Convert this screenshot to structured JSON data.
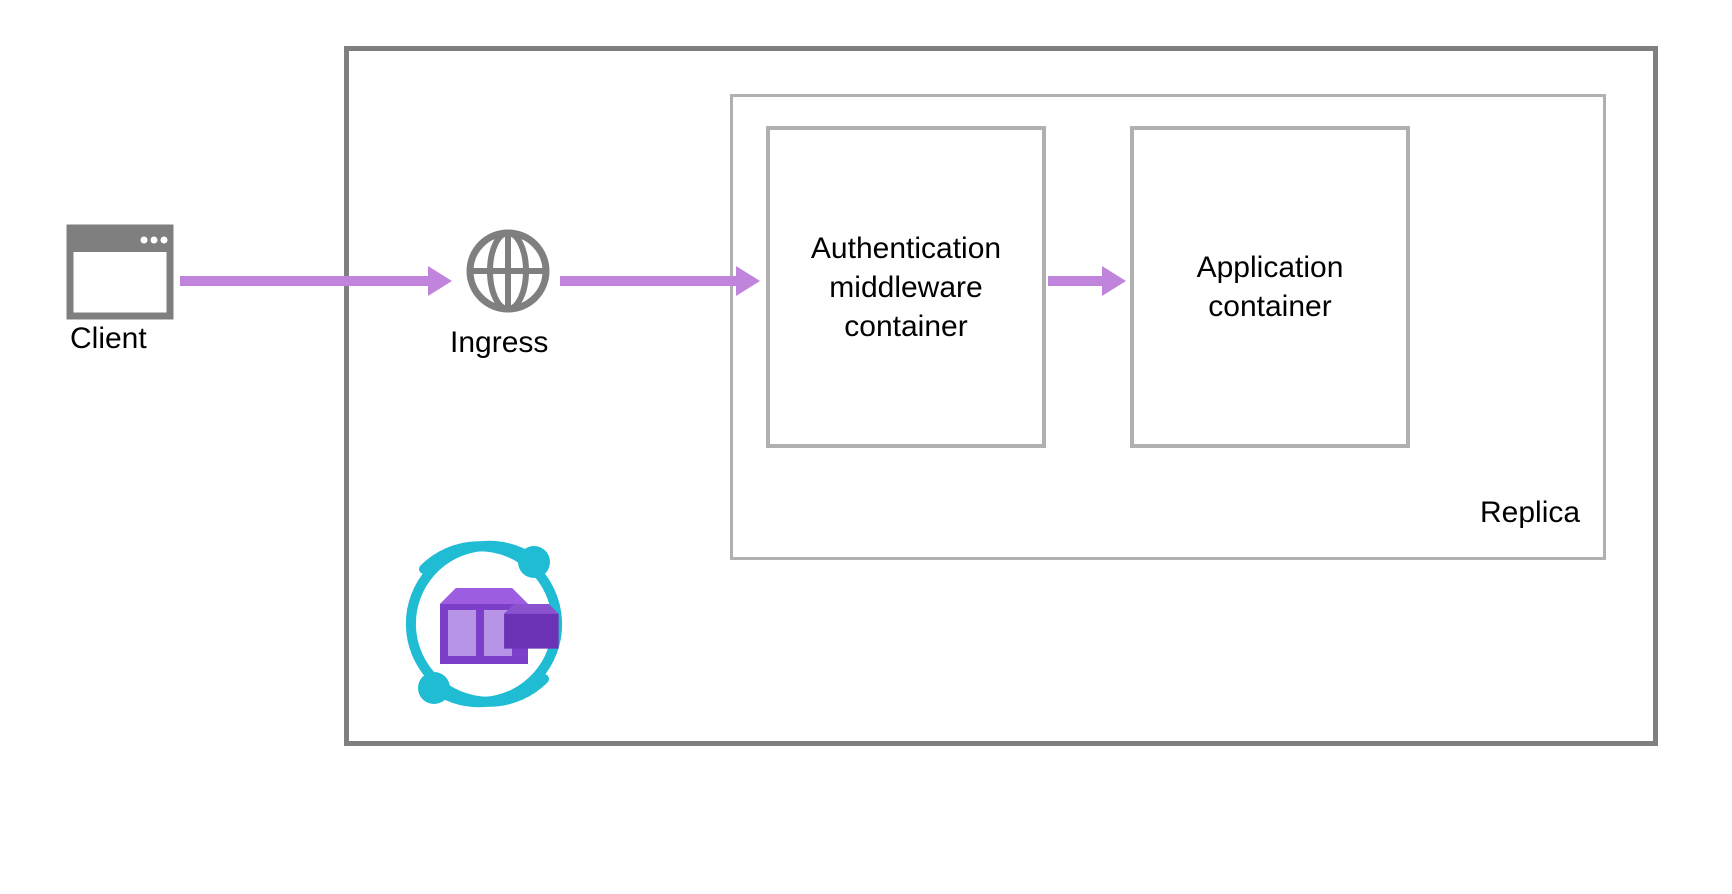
{
  "diagram": {
    "client_label": "Client",
    "ingress_label": "Ingress",
    "replica_label": "Replica",
    "auth_box_text": "Authentication middleware container",
    "app_box_text": "Application container"
  }
}
